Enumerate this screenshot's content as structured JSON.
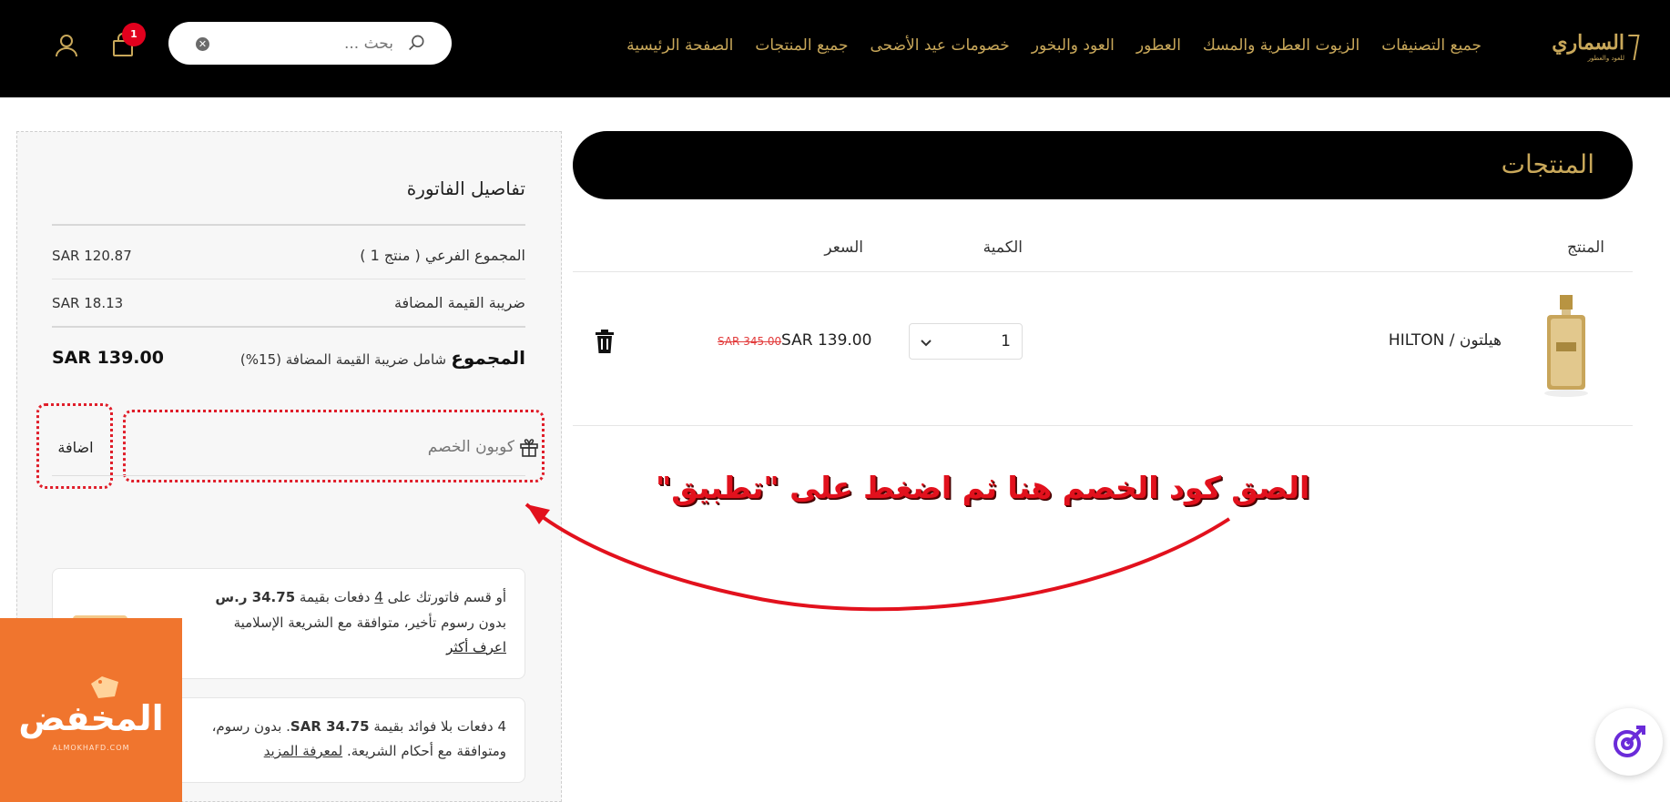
{
  "header": {
    "logo": {
      "main": "السماري",
      "sub": "للعود والعطور"
    },
    "nav": [
      "الصفحة الرئيسية",
      "جميع المنتجات",
      "خصومات عيد الأضحى",
      "العود والبخور",
      "العطور",
      "الزيوت العطرية والمسك",
      "جميع التصنيفات"
    ],
    "search": {
      "placeholder": "بحث ..."
    },
    "cart_count": "1",
    "icons": {
      "search": "search-icon",
      "clear": "clear-icon",
      "cart": "shopping-bag-icon",
      "user": "user-icon"
    }
  },
  "products": {
    "title": "المنتجات",
    "columns": {
      "product": "المنتج",
      "quantity": "الكمية",
      "price": "السعر"
    },
    "items": [
      {
        "name": "هيلتون / HILTON",
        "quantity": "1",
        "price": "SAR 139.00",
        "old_price": "SAR 345.00"
      }
    ]
  },
  "invoice": {
    "title": "تفاصيل الفاتورة",
    "subtotal_label": "المجموع الفرعي ( منتج 1 )",
    "subtotal_value": "SAR 120.87",
    "vat_label": "ضريبة القيمة المضافة",
    "vat_value": "SAR 18.13",
    "total_label": "المجموع",
    "total_note": "شامل ضريبة القيمة المضافة (15%)",
    "total_value": "SAR 139.00",
    "coupon_placeholder": "كوبون الخصم",
    "add_label": "اضافة"
  },
  "installments": {
    "tabby_line1_a": "أو قسم فاتورتك على",
    "tabby_count": "4",
    "tabby_line1_b": "دفعات بقيمة",
    "tabby_amount": "34.75 ر.س",
    "tabby_line2": "بدون رسوم تأخير، متوافقة مع الشريعة الإسلامية",
    "tabby_link": "اعرف أكثر",
    "tamara_line1_a": "4 دفعات بلا فوائد بقيمة",
    "tamara_amount": "SAR 34.75",
    "tamara_line1_b": ". بدون رسوم،",
    "tamara_line2": "ومتوافقة مع أحكام الشريعة.",
    "tamara_link": "لمعرفة المزيد"
  },
  "annotation": {
    "text": "الصق كود الخصم هنا ثم اضغط على \"تطبيق\"",
    "color": "#e2111d"
  },
  "brand": {
    "name": "المخفض",
    "url": "ALMOKHAFD.COM",
    "color": "#f0752e"
  },
  "colors": {
    "gold": "#c9a85a",
    "header_bg": "#000000",
    "badge": "#e1001d"
  }
}
